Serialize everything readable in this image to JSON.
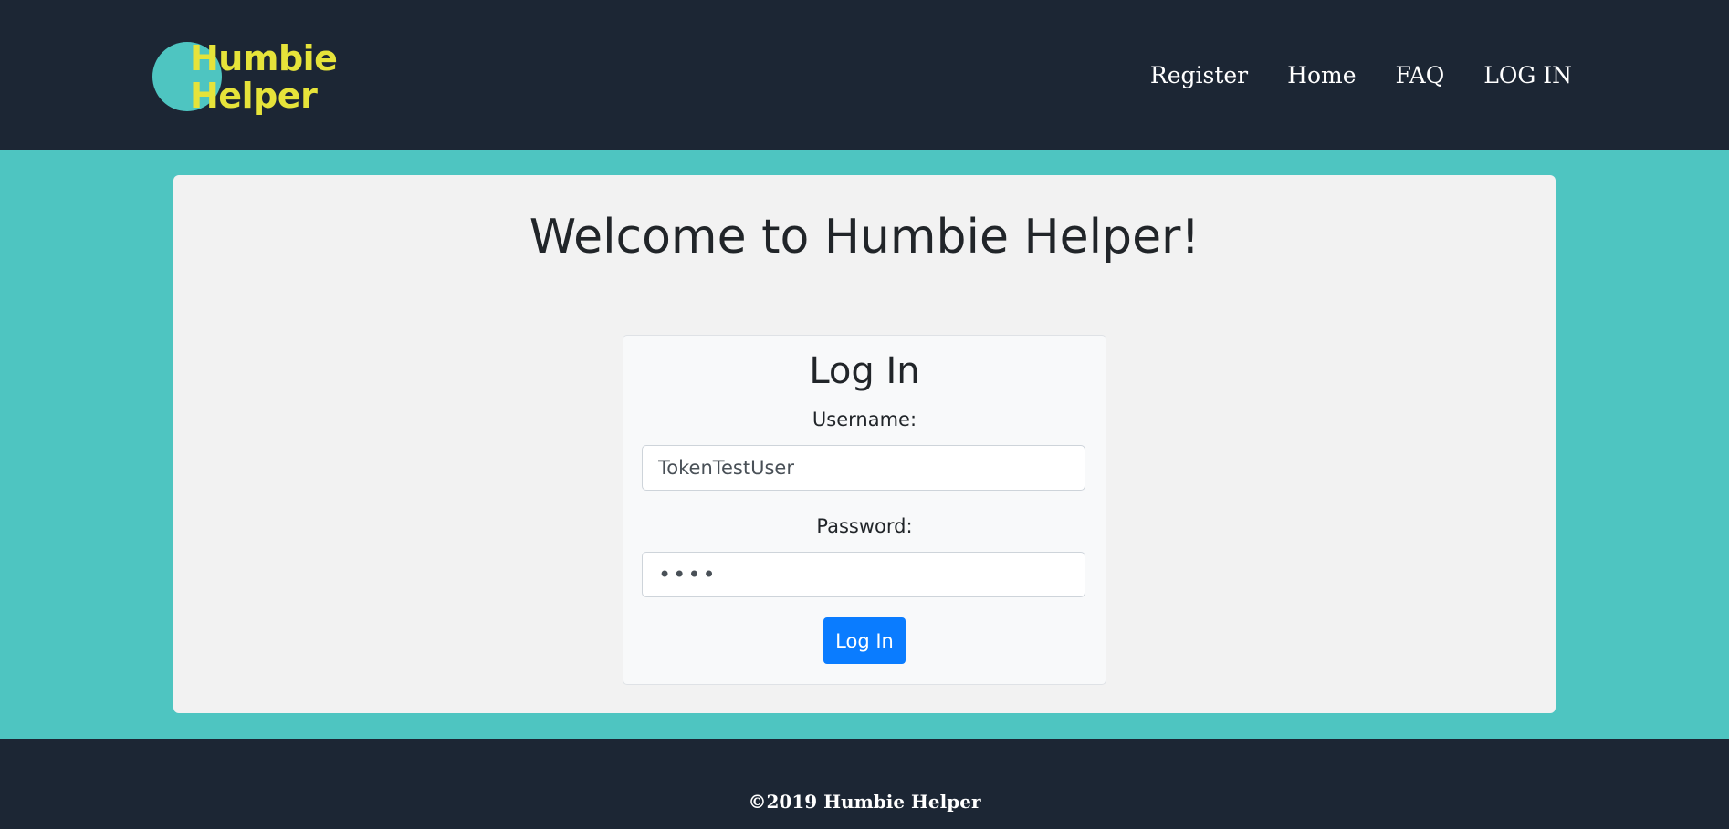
{
  "header": {
    "logo_line1": "Humbie",
    "logo_line2": "Helper",
    "nav": [
      "Register",
      "Home",
      "FAQ",
      "LOG IN"
    ]
  },
  "main": {
    "welcome_title": "Welcome to Humbie Helper!"
  },
  "login": {
    "title": "Log In",
    "username_label": "Username:",
    "username_value": "TokenTestUser",
    "password_label": "Password:",
    "password_value": "pass",
    "submit_label": "Log In"
  },
  "footer": {
    "copyright": "©2019 Humbie Helper"
  },
  "colors": {
    "header_bg": "#1c2634",
    "main_bg": "#4ec5c1",
    "logo_text": "#e6e33a",
    "button_bg": "#0a7cff"
  }
}
